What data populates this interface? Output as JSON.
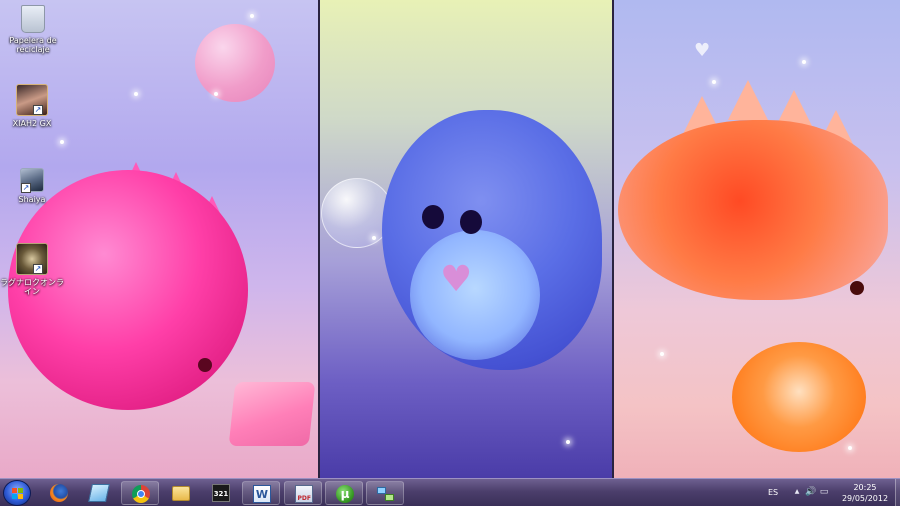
{
  "desktop": {
    "icons": [
      {
        "label": "Papelera de reciclaje",
        "icon": "recycle-bin-icon"
      },
      {
        "label": "XIAH2 GX",
        "icon": "game-shortcut-icon"
      },
      {
        "label": "Shaiya",
        "icon": "game-shortcut-icon"
      },
      {
        "label": "ラグナロクオンライン",
        "icon": "game-shortcut-icon"
      }
    ]
  },
  "taskbar": {
    "start_icon": "windows-logo-icon",
    "pinned": [
      {
        "name": "firefox",
        "icon": "firefox-icon"
      },
      {
        "name": "notepad",
        "icon": "notepad-icon"
      },
      {
        "name": "chrome",
        "icon": "chrome-icon"
      },
      {
        "name": "explorer",
        "icon": "folder-icon"
      },
      {
        "name": "media-player",
        "icon": "film-icon"
      },
      {
        "name": "word",
        "icon": "word-icon"
      },
      {
        "name": "pdf",
        "icon": "pdf-icon"
      },
      {
        "name": "utorrent",
        "icon": "utorrent-icon"
      },
      {
        "name": "network",
        "icon": "network-icon"
      }
    ],
    "word_glyph": "W",
    "film_glyph": "321",
    "utorrent_glyph": "µ",
    "pdf_glyph": "PDF",
    "tray": {
      "language": "ES",
      "show_hidden": "▲",
      "volume": "🔊",
      "network": "▭",
      "time": "20:25",
      "date": "29/05/2012"
    }
  },
  "colors": {
    "taskbar_top": "#6e6090",
    "taskbar_bottom": "#3a2f58",
    "pink_dino": "#ff3fa8",
    "blue_dino": "#5a6ee6",
    "orange_dino": "#ff4a24"
  }
}
